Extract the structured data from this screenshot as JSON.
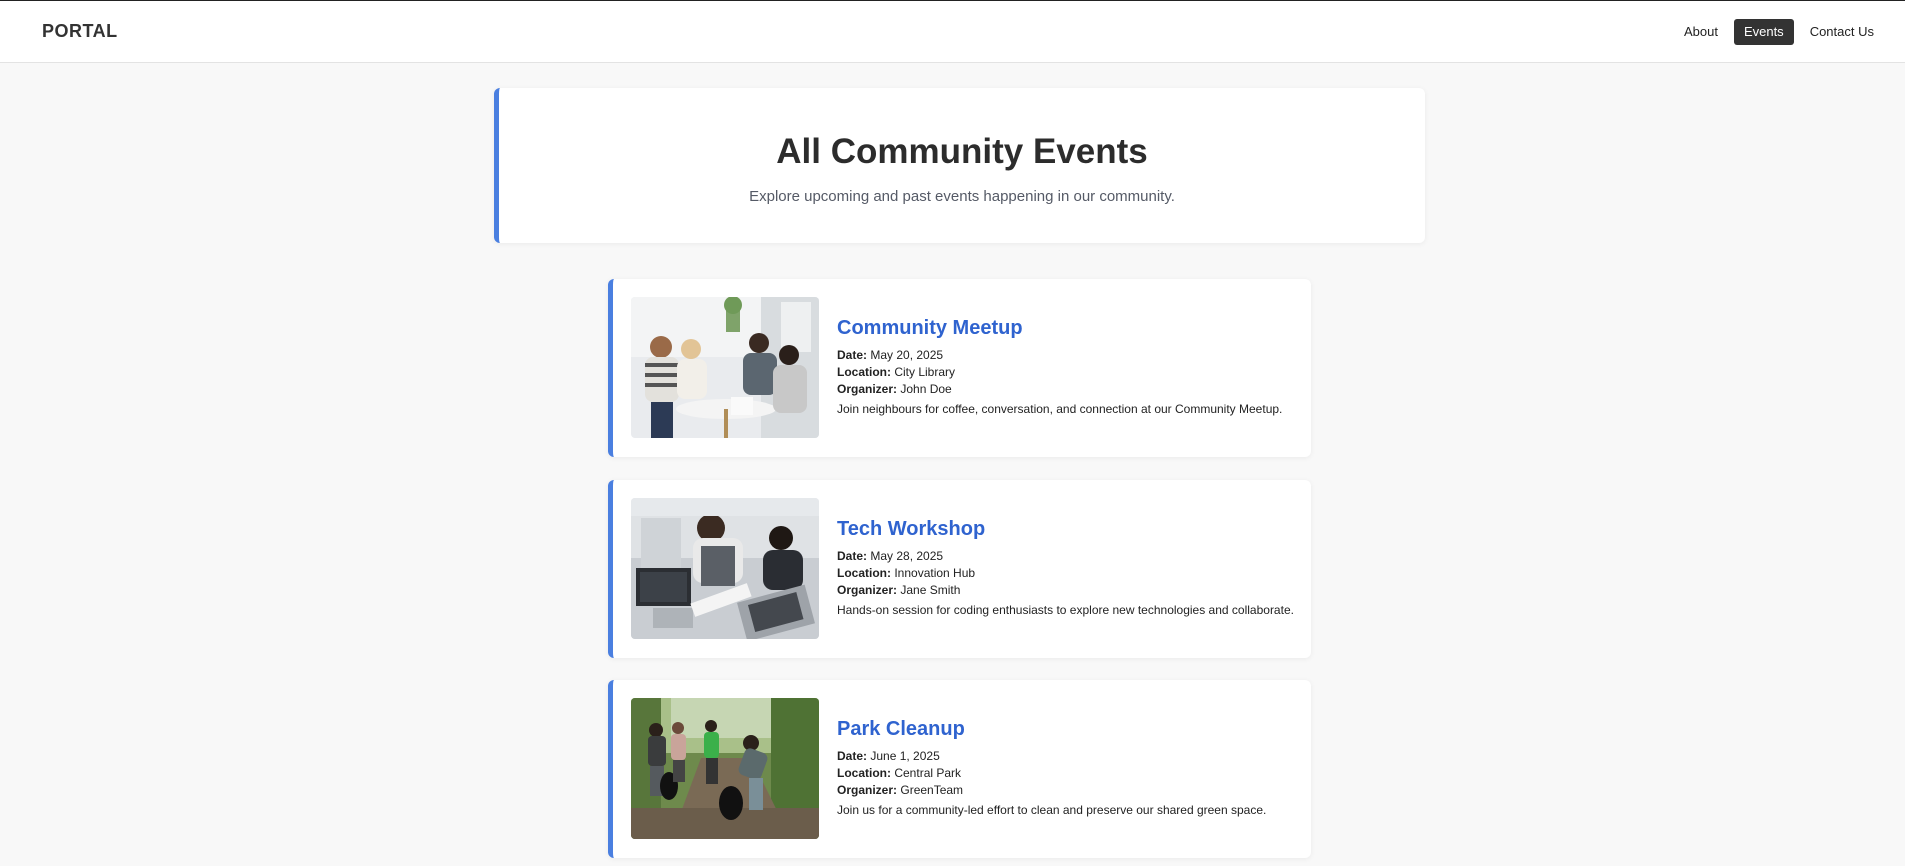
{
  "brand": "PORTAL",
  "nav": {
    "items": [
      {
        "label": "About"
      },
      {
        "label": "Events"
      },
      {
        "label": "Contact Us"
      }
    ],
    "active": "Events"
  },
  "hero": {
    "title": "All Community Events",
    "subtitle": "Explore upcoming and past events happening in our community."
  },
  "labels": {
    "date": "Date:",
    "location": "Location:",
    "organizer": "Organizer:"
  },
  "events": [
    {
      "title": "Community Meetup",
      "date": "May 20, 2025",
      "location": "City Library",
      "organizer": "John Doe",
      "description": "Join neighbours for coffee, conversation, and connection at our Community Meetup."
    },
    {
      "title": "Tech Workshop",
      "date": "May 28, 2025",
      "location": "Innovation Hub",
      "organizer": "Jane Smith",
      "description": "Hands-on session for coding enthusiasts to explore new technologies and collaborate."
    },
    {
      "title": "Park Cleanup",
      "date": "June 1, 2025",
      "location": "Central Park",
      "organizer": "GreenTeam",
      "description": "Join us for a community-led effort to clean and preserve our shared green space."
    }
  ],
  "colors": {
    "accent": "#4a7fe0",
    "title_blue": "#2f63cf",
    "active_nav_bg": "#333333",
    "page_bg": "#f8f8f8"
  }
}
